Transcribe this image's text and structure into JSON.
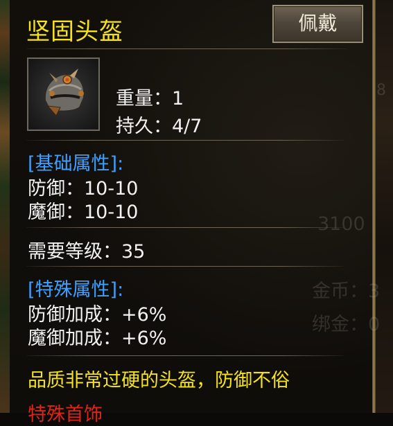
{
  "tooltip": {
    "title": "坚固头盔",
    "equip_button": "佩戴",
    "weight": "重量：1",
    "durability": "持久：4/7",
    "base_section": "[基础属性]:",
    "defense": "防御：10-10",
    "magic_defense": "魔御：10-10",
    "required_level": "需要等级：35",
    "special_section": "[特殊属性]:",
    "defense_bonus": "防御加成：+6%",
    "magic_defense_bonus": "魔御加成：+6%",
    "description": "品质非常过硬的头盔，防御不俗",
    "special_label": "特殊首饰"
  },
  "background": {
    "amount": "3100",
    "gold": "金币：3",
    "bound_gold": "绑金：0",
    "side_number": "8"
  },
  "colors": {
    "title": "#f4e21e",
    "section": "#3ea0ff",
    "stat": "#f2f2f2",
    "special": "#e0241a"
  },
  "icons": {
    "item": "helmet-icon"
  }
}
